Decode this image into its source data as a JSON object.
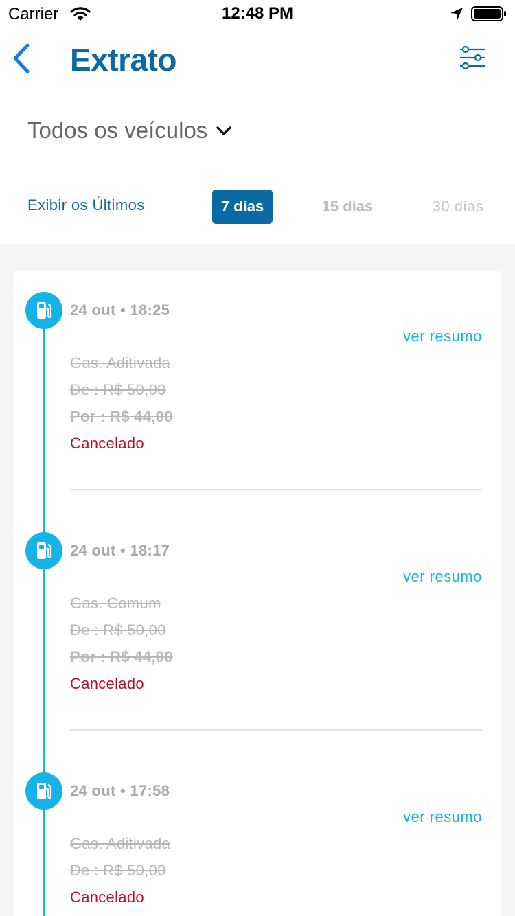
{
  "status_bar": {
    "carrier": "Carrier",
    "time": "12:48 PM",
    "icons": [
      "wifi-icon",
      "location-arrow-icon",
      "battery-icon"
    ]
  },
  "header": {
    "title": "Extrato",
    "back_icon": "chevron-left-icon",
    "filter_icon": "sliders-icon"
  },
  "vehicle_filter": {
    "selected": "Todos os veículos",
    "icon": "chevron-down-icon"
  },
  "period_filter": {
    "label": "Exibir os Últimos",
    "options": [
      "7 dias",
      "15 dias",
      "30 dias"
    ],
    "selected": "7 dias"
  },
  "transactions": [
    {
      "date": "24 out • 18:25",
      "link": "ver resumo",
      "fuel": "Gas. Aditivada",
      "price_from": "De : R$ 50,00",
      "price_by": "Por : R$ 44,00",
      "status": "Cancelado"
    },
    {
      "date": "24 out • 18:17",
      "link": "ver resumo",
      "fuel": "Gas. Comum",
      "price_from": "De : R$ 50,00",
      "price_by": "Por : R$ 44,00",
      "status": "Cancelado"
    },
    {
      "date": "24 out • 17:58",
      "link": "ver resumo",
      "fuel": "Gas. Aditivada",
      "price_from": "De : R$ 50,00",
      "status": "Cancelado"
    }
  ],
  "colors": {
    "brand_blue": "#0b6aa4",
    "accent_cyan": "#16b4e6",
    "status_cancelled": "#c20d2a",
    "struck_text": "#b8b8b8",
    "list_background": "#f4f5f7"
  }
}
